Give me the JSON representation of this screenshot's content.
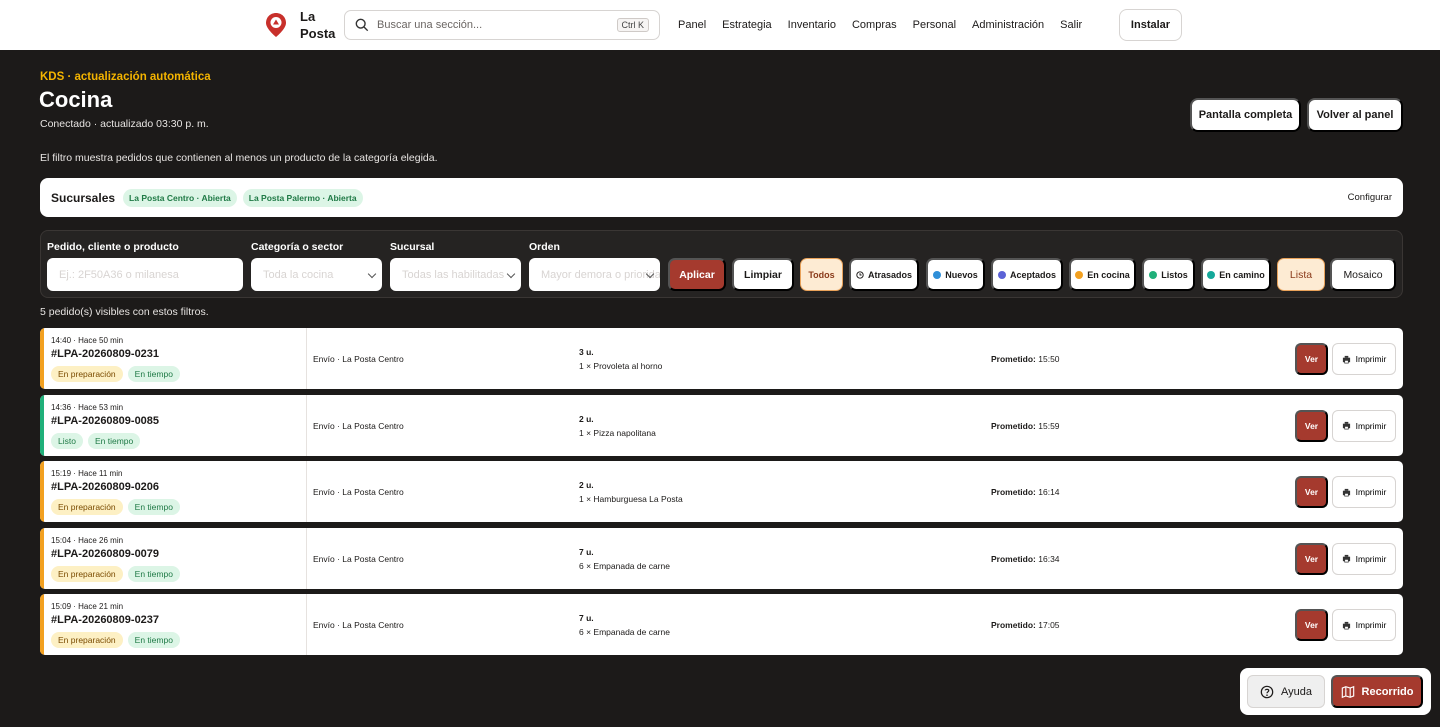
{
  "brand": {
    "name": "La Posta"
  },
  "search": {
    "placeholder": "Buscar una sección...",
    "shortcut": "Ctrl K"
  },
  "nav": {
    "links": [
      "Panel",
      "Estrategia",
      "Inventario",
      "Compras",
      "Personal",
      "Administración",
      "Salir"
    ],
    "install": "Instalar"
  },
  "header": {
    "eyebrow": "KDS · actualización automática",
    "title": "Cocina",
    "status": "Conectado · actualizado 03:30 p. m.",
    "fullscreen": "Pantalla completa",
    "back": "Volver al panel",
    "filter_note": "El filtro muestra pedidos que contienen al menos un producto de la categoría elegida."
  },
  "branches": {
    "label": "Sucursales",
    "items": [
      "La Posta Centro · Abierta",
      "La Posta Palermo · Abierta"
    ],
    "configure": "Configurar"
  },
  "filters": {
    "query_label": "Pedido, cliente o producto",
    "query_placeholder": "Ej.: 2F50A36 o milanesa",
    "category_label": "Categoría o sector",
    "category_value": "Toda la cocina",
    "branch_label": "Sucursal",
    "branch_value": "Todas las habilitadas",
    "order_label": "Orden",
    "order_value": "Mayor demora o prioridad",
    "apply": "Aplicar",
    "clear": "Limpiar",
    "chips": [
      {
        "label": "Todos",
        "dot": ""
      },
      {
        "label": "Atrasados",
        "dot": "clock"
      },
      {
        "label": "Nuevos",
        "dot": "#2f8fd8"
      },
      {
        "label": "Aceptados",
        "dot": "#5b62d6"
      },
      {
        "label": "En cocina",
        "dot": "#f2a020"
      },
      {
        "label": "Listos",
        "dot": "#20b07a"
      },
      {
        "label": "En camino",
        "dot": "#14a89a"
      }
    ],
    "view_list": "Lista",
    "view_mosaic": "Mosaico"
  },
  "summary": "5 pedido(s) visibles con estos filtros.",
  "orders": [
    {
      "time": "14:40 · Hace 50 min",
      "code": "#LPA-20260809-0231",
      "status": "En preparación",
      "timing": "En tiempo",
      "dest": "Envío · La Posta Centro",
      "units": "3 u.",
      "item": "1 × Provoleta al horno",
      "promised_label": "Prometido:",
      "promised": "15:50",
      "accent": "#f2a020"
    },
    {
      "time": "14:36 · Hace 53 min",
      "code": "#LPA-20260809-0085",
      "status": "Listo",
      "timing": "En tiempo",
      "dest": "Envío · La Posta Centro",
      "units": "2 u.",
      "item": "1 × Pizza napolitana",
      "promised_label": "Prometido:",
      "promised": "15:59",
      "accent": "#20b07a"
    },
    {
      "time": "15:19 · Hace 11 min",
      "code": "#LPA-20260809-0206",
      "status": "En preparación",
      "timing": "En tiempo",
      "dest": "Envío · La Posta Centro",
      "units": "2 u.",
      "item": "1 × Hamburguesa La Posta",
      "promised_label": "Prometido:",
      "promised": "16:14",
      "accent": "#f2a020"
    },
    {
      "time": "15:04 · Hace 26 min",
      "code": "#LPA-20260809-0079",
      "status": "En preparación",
      "timing": "En tiempo",
      "dest": "Envío · La Posta Centro",
      "units": "7 u.",
      "item": "6 × Empanada de carne",
      "promised_label": "Prometido:",
      "promised": "16:34",
      "accent": "#f2a020"
    },
    {
      "time": "15:09 · Hace 21 min",
      "code": "#LPA-20260809-0237",
      "status": "En preparación",
      "timing": "En tiempo",
      "dest": "Envío · La Posta Centro",
      "units": "7 u.",
      "item": "6 × Empanada de carne",
      "promised_label": "Prometido:",
      "promised": "17:05",
      "accent": "#f2a020"
    }
  ],
  "order_actions": {
    "view": "Ver",
    "print": "Imprimir"
  },
  "floating": {
    "help": "Ayuda",
    "tour": "Recorrido"
  },
  "colors": {
    "accent": "#a53a2e",
    "background": "#1c1a19",
    "eyebrow": "#f4b400"
  }
}
